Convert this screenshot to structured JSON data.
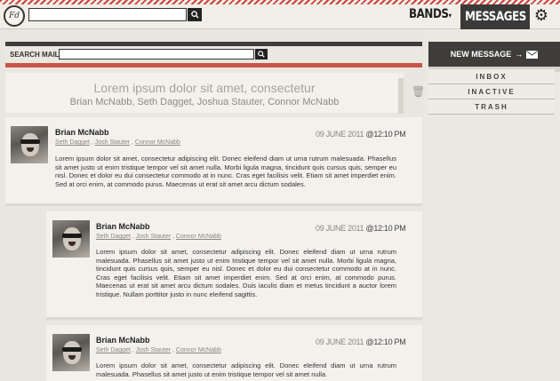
{
  "app": {
    "logo_text": "Fd"
  },
  "nav": {
    "bands_label": "BANDS",
    "messages_label": "MESSAGES"
  },
  "search_mail": {
    "label": "SEARCH MAIL"
  },
  "thread": {
    "subject": "Lorem ipsum dolor sit amet, consectetur",
    "participants": "Brian McNabb, Seth Dagget, Joshua Stauter, Connor McNabb"
  },
  "messages": [
    {
      "sender": "Brian McNabb",
      "recipients": [
        "Seth Dagget",
        "Josh Stauter",
        "Connor McNabb"
      ],
      "date": "09 JUNE 2011",
      "time": "@12:10 PM",
      "body": "Lorem ipsum dolor sit amet, consectetur adipiscing elit. Donec eleifend diam ut urna rutrum malesuada. Phasellus sit amet justo ut enim tristique tempor vel sit amet nulla. Morbi ligula magna, tincidunt quis cursus quis, semper eu nisl. Donec et dolor eu dui consectetur commodo at in nunc. Cras eget facilisis velit. Etiam sit amet imperdiet enim. Sed at orci enim, at commodo purus. Maecenas ut erat sit amet arcu dictum sodales."
    },
    {
      "sender": "Brian McNabb",
      "recipients": [
        "Seth Dagget",
        "Josh Stauter",
        "Connor McNabb"
      ],
      "date": "09 JUNE 2011",
      "time": "@12:10 PM",
      "body": "Lorem ipsum dolor sit amet, consectetur adipiscing elit. Donec eleifend diam ut urna rutrum malesuada. Phasellus sit amet justo ut enim tristique tempor vel sit amet nulla. Morbi ligula magna, tincidunt quis cursus quis, semper eu nisl. Donec et dolor eu dui consectetur commodo at in nunc. Cras eget facilisis velit. Etiam sit amet imperdiet enim. Sed at orci enim, at commodo purus. Maecenas ut erat sit amet arcu dictum sodales. Duis iaculis diam et metus tincidunt a auctor lorem tristique. Nullam porttitor justo in nunc eleifend sagittis."
    },
    {
      "sender": "Brian McNabb",
      "recipients": [
        "Seth Dagget",
        "Josh Stauter",
        "Connor McNabb"
      ],
      "date": "09 JUNE 2011",
      "time": "@12:10 PM",
      "body": "Lorem ipsum dolor sit amet, consectetur adipiscing elit. Donec eleifend diam ut urna rutrum malesuada. Phasellus sit amet justo ut enim tristique tempor vel sit amet nulla."
    }
  ],
  "sidebar": {
    "new_message_label": "NEW MESSAGE",
    "folders": [
      "INBOX",
      "INACTIVE",
      "TRASH"
    ]
  },
  "icons": {
    "search": "search-icon",
    "gear": "gear-icon",
    "envelope": "envelope-icon",
    "trash": "trash-icon"
  },
  "colors": {
    "accent_red": "#c9544a",
    "dark": "#3e3d3b"
  }
}
